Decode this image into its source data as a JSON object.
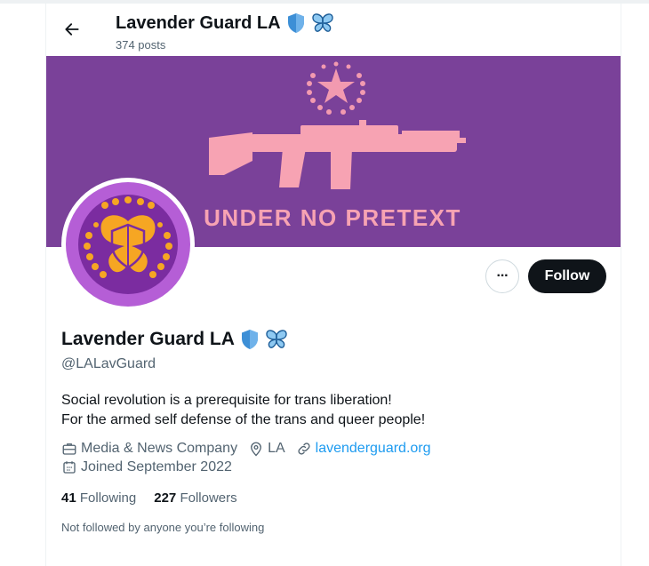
{
  "header": {
    "title": "Lavender Guard LA",
    "posts": "374 posts"
  },
  "banner": {
    "text": "UNDER NO PRETEXT",
    "background": "#7a4199",
    "accent": "#f7a3b3"
  },
  "avatar": {
    "background": "#b55ed6",
    "emblem": "#f6a623"
  },
  "actions": {
    "more": "···",
    "follow": "Follow"
  },
  "profile": {
    "name": "Lavender Guard LA",
    "handle": "@LALavGuard",
    "bio_line1": "Social revolution is a prerequisite for trans liberation!",
    "bio_line2": "For the armed self defense of the trans and queer people!",
    "category": "Media & News Company",
    "location": "LA",
    "website": "lavenderguard.org",
    "joined": "Joined September 2022"
  },
  "stats": {
    "following_count": "41",
    "following_label": "Following",
    "followers_count": "227",
    "followers_label": "Followers"
  },
  "not_followed": "Not followed by anyone you’re following",
  "icons": {
    "back": "arrow-left-icon",
    "shield": "shield-icon",
    "butterfly": "butterfly-icon",
    "briefcase": "briefcase-icon",
    "location": "location-pin-icon",
    "link": "link-icon",
    "calendar": "calendar-icon"
  },
  "colors": {
    "link": "#1d9bf0",
    "muted": "#536471",
    "text": "#0f1419"
  }
}
